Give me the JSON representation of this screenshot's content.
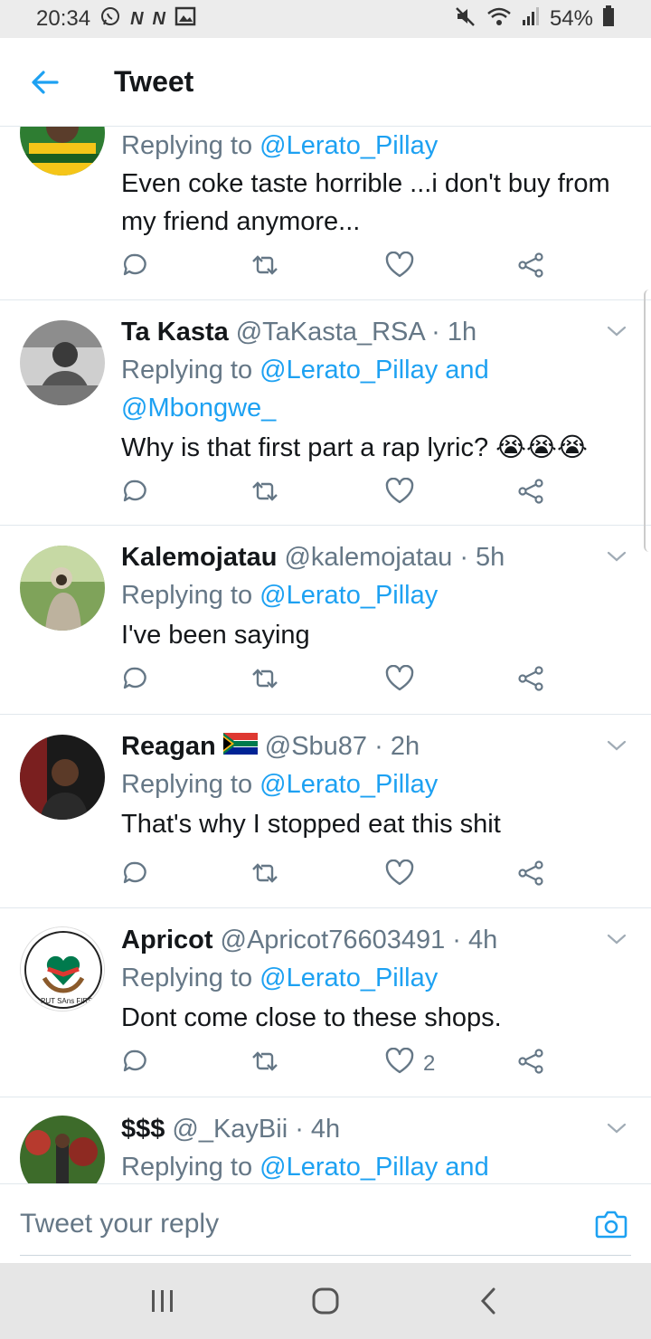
{
  "status_bar": {
    "time": "20:34",
    "notif_icons": [
      "whatsapp-icon",
      "n-icon",
      "n-icon",
      "image-icon"
    ],
    "battery": "54%"
  },
  "header": {
    "title": "Tweet"
  },
  "tweets": [
    {
      "user": "",
      "handle": "",
      "time": "",
      "replying_prefix": "Replying to ",
      "mentions": "@Lerato_Pillay",
      "mentions2": "",
      "text": "Even coke taste horrible ...i don't buy from",
      "text2": "my friend anymore...",
      "likes": ""
    },
    {
      "user": "Ta Kasta",
      "handle": "@TaKasta_RSA · 1h",
      "replying_prefix": "Replying to ",
      "mentions": "@Lerato_Pillay and",
      "mentions2": "@Mbongwe_",
      "text": "Why is that first part a rap lyric? 😭😭😭",
      "likes": ""
    },
    {
      "user": "Kalemojatau",
      "handle": "@kalemojatau · 5h",
      "replying_prefix": "Replying to ",
      "mentions": "@Lerato_Pillay",
      "text": "I've been saying",
      "likes": ""
    },
    {
      "user": "Reagan",
      "handle": "@Sbu87 · 2h",
      "replying_prefix": "Replying to ",
      "mentions": "@Lerato_Pillay",
      "text": "That's why I stopped eat this shit",
      "likes": ""
    },
    {
      "user": "Apricot",
      "handle": "@Apricot76603491 · 4h",
      "replying_prefix": "Replying to ",
      "mentions": "@Lerato_Pillay",
      "text": "Dont come close to these shops.",
      "likes": "2",
      "avatar_logo_text": "PUT SAns FIRST"
    },
    {
      "user": "$$$",
      "handle": "@_KayBii · 4h",
      "replying_prefix": "Replying to ",
      "mentions": "@Lerato_Pillay and",
      "text": "",
      "likes": ""
    }
  ],
  "reply_bar": {
    "placeholder": "Tweet your reply"
  },
  "colors": {
    "accent": "#1da1f2",
    "secondary_text": "#657786",
    "divider": "#e1e8ed"
  }
}
